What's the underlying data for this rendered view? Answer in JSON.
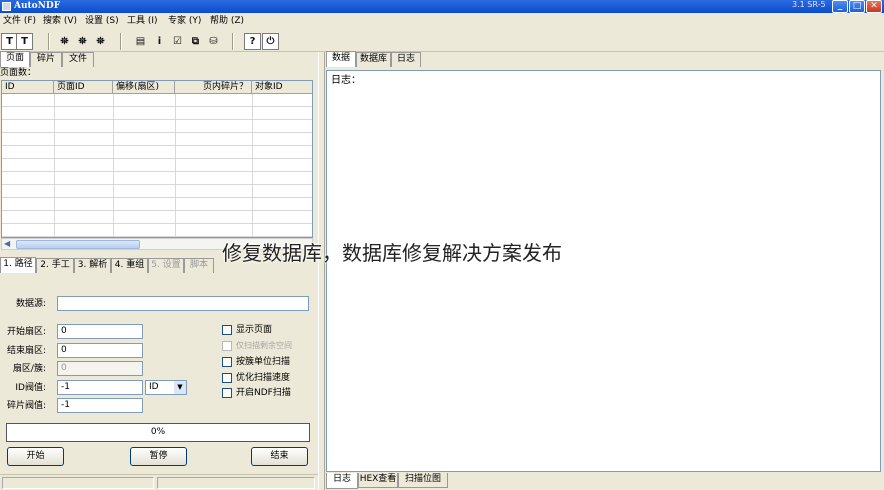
{
  "window": {
    "title": "AutoNDF",
    "version": "3.1 SR-5"
  },
  "menu": [
    "文件 (F)",
    "搜索 (V)",
    "设置 (S)",
    "工具 (I)",
    "专家 (Y)",
    "帮助 (Z)"
  ],
  "left": {
    "tabs_top": [
      "页面",
      "碎片",
      "文件"
    ],
    "page_count_label": "页面数：",
    "columns": [
      "ID",
      "页面ID",
      "偏移(扇区)",
      "页内碎片？",
      "对象ID"
    ],
    "tabs_bottom": [
      "1. 路径",
      "2. 手工",
      "3. 解析",
      "4. 重组",
      "5. 设置",
      "脚本"
    ],
    "form": {
      "datasource_label": "数据源:",
      "datasource_value": "",
      "start_sector_label": "开始扇区:",
      "start_sector_value": "0",
      "end_sector_label": "结束扇区:",
      "end_sector_value": "0",
      "sector_cluster_label": "扇区/簇:",
      "sector_cluster_value": "0",
      "id_threshold_label": "ID阀值:",
      "id_threshold_value": "-1",
      "id_select_value": "ID",
      "fragment_threshold_label": "碎片阀值:",
      "fragment_threshold_value": "-1",
      "checkboxes": [
        {
          "label": "显示页面",
          "enabled": true
        },
        {
          "label": "仅扫描剩余空间",
          "enabled": false
        },
        {
          "label": "按簇单位扫描",
          "enabled": true
        },
        {
          "label": "优化扫描速度",
          "enabled": true
        },
        {
          "label": "开启NDF扫描",
          "enabled": true
        }
      ]
    },
    "progress_text": "0%",
    "buttons": {
      "start": "开始",
      "pause": "暂停",
      "end": "结束"
    }
  },
  "right": {
    "tabs_top": [
      "数据",
      "数据库",
      "日志"
    ],
    "log_label": "日志：",
    "tabs_bottom": [
      "日志",
      "HEX查看",
      "扫描位图"
    ]
  },
  "watermark": "修复数据库，数据库修复解决方案发布"
}
